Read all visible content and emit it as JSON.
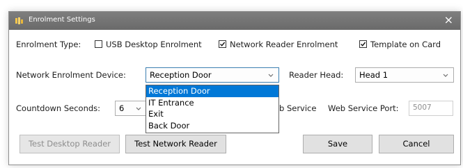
{
  "window": {
    "title": "Enrolment Settings",
    "close_glyph": "×"
  },
  "enrolment_type": {
    "label": "Enrolment Type:",
    "options": [
      {
        "label": "USB Desktop Enrolment",
        "checked": false
      },
      {
        "label": "Network Reader Enrolment",
        "checked": true
      },
      {
        "label": "Template on Card",
        "checked": true
      }
    ]
  },
  "device": {
    "label": "Network Enrolment Device:",
    "value": "Reception Door",
    "options": [
      "Reception Door",
      "IT Entrance",
      "Exit",
      "Back Door"
    ],
    "selected_index": 0
  },
  "reader_head": {
    "label": "Reader Head:",
    "value": "Head 1"
  },
  "countdown": {
    "label": "Countdown Seconds:",
    "value": "6"
  },
  "web_service": {
    "partial_label": "b Service",
    "port_label": "Web Service Port:",
    "port_value": "5007"
  },
  "buttons": {
    "test_desktop": "Test Desktop Reader",
    "test_network": "Test Network Reader",
    "save": "Save",
    "cancel": "Cancel"
  },
  "colors": {
    "selection": "#0078d7",
    "titlebar": "#737373",
    "focus_border": "#3c7fb1"
  },
  "icons": {
    "app": "key-settings-icon",
    "close": "close-icon",
    "dropdown": "chevron-down-icon",
    "check": "checkmark-icon"
  }
}
